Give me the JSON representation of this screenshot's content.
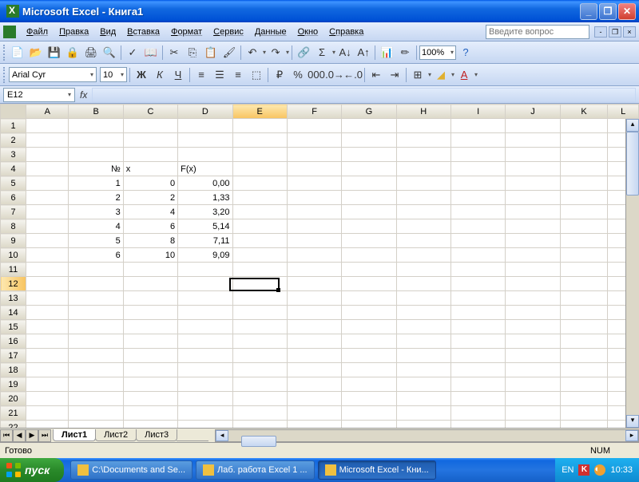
{
  "title": "Microsoft Excel - Книга1",
  "menus": [
    "Файл",
    "Правка",
    "Вид",
    "Вставка",
    "Формат",
    "Сервис",
    "Данные",
    "Окно",
    "Справка"
  ],
  "help_placeholder": "Введите вопрос",
  "zoom": "100%",
  "font_name": "Arial Cyr",
  "font_size": "10",
  "active_cell": "E12",
  "formula_value": "",
  "columns": [
    "A",
    "B",
    "C",
    "D",
    "E",
    "F",
    "G",
    "H",
    "I",
    "J",
    "K",
    "L"
  ],
  "rows": 22,
  "cells": {
    "B4": "№",
    "C4": "x",
    "D4": "F(x)",
    "B5": "1",
    "C5": "0",
    "D5": "0,00",
    "B6": "2",
    "C6": "2",
    "D6": "1,33",
    "B7": "3",
    "C7": "4",
    "D7": "3,20",
    "B8": "4",
    "C8": "6",
    "D8": "5,14",
    "B9": "5",
    "C9": "8",
    "D9": "7,11",
    "B10": "6",
    "C10": "10",
    "D10": "9,09"
  },
  "sheets": [
    "Лист1",
    "Лист2",
    "Лист3"
  ],
  "active_sheet": 0,
  "status": "Готово",
  "indicators": {
    "num": "NUM"
  },
  "taskbar": {
    "start": "пуск",
    "items": [
      {
        "label": "C:\\Documents and Se...",
        "active": false
      },
      {
        "label": "Лаб. работа Excel 1 ...",
        "active": false
      },
      {
        "label": "Microsoft Excel - Кни...",
        "active": true
      }
    ],
    "lang": "EN",
    "clock": "10:33"
  }
}
